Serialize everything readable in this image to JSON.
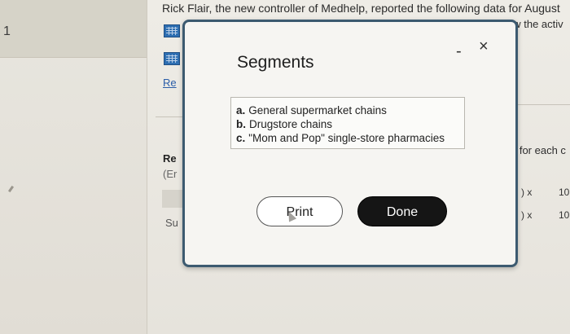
{
  "background": {
    "left_number": "1",
    "header_text": "Rick Flair, the new controller of Medhelp, reported the following data for August",
    "header_right_fragment": "ew the activ",
    "link_fragment": "Re",
    "bold_fragment": "Re",
    "paren_fragment": "(Er",
    "su_fragment": "Su",
    "for_each_fragment": "e for each c",
    "rows": [
      {
        "x_label": ") x",
        "value": "10"
      },
      {
        "x_label": ") x",
        "value": "10"
      }
    ]
  },
  "modal": {
    "title": "Segments",
    "minimize_symbol": "-",
    "close_symbol": "×",
    "segments": [
      {
        "letter": "a.",
        "text": "General supermarket chains"
      },
      {
        "letter": "b.",
        "text": "Drugstore chains"
      },
      {
        "letter": "c.",
        "text": "\"Mom and Pop\" single-store pharmacies"
      }
    ],
    "print_label": "Print",
    "done_label": "Done"
  },
  "colors": {
    "modal_border": "#3c5a70",
    "done_button": "#151515",
    "grid_icon": "#2e6fb2"
  },
  "icons": [
    "grid-icon",
    "minimize-icon",
    "close-icon"
  ]
}
